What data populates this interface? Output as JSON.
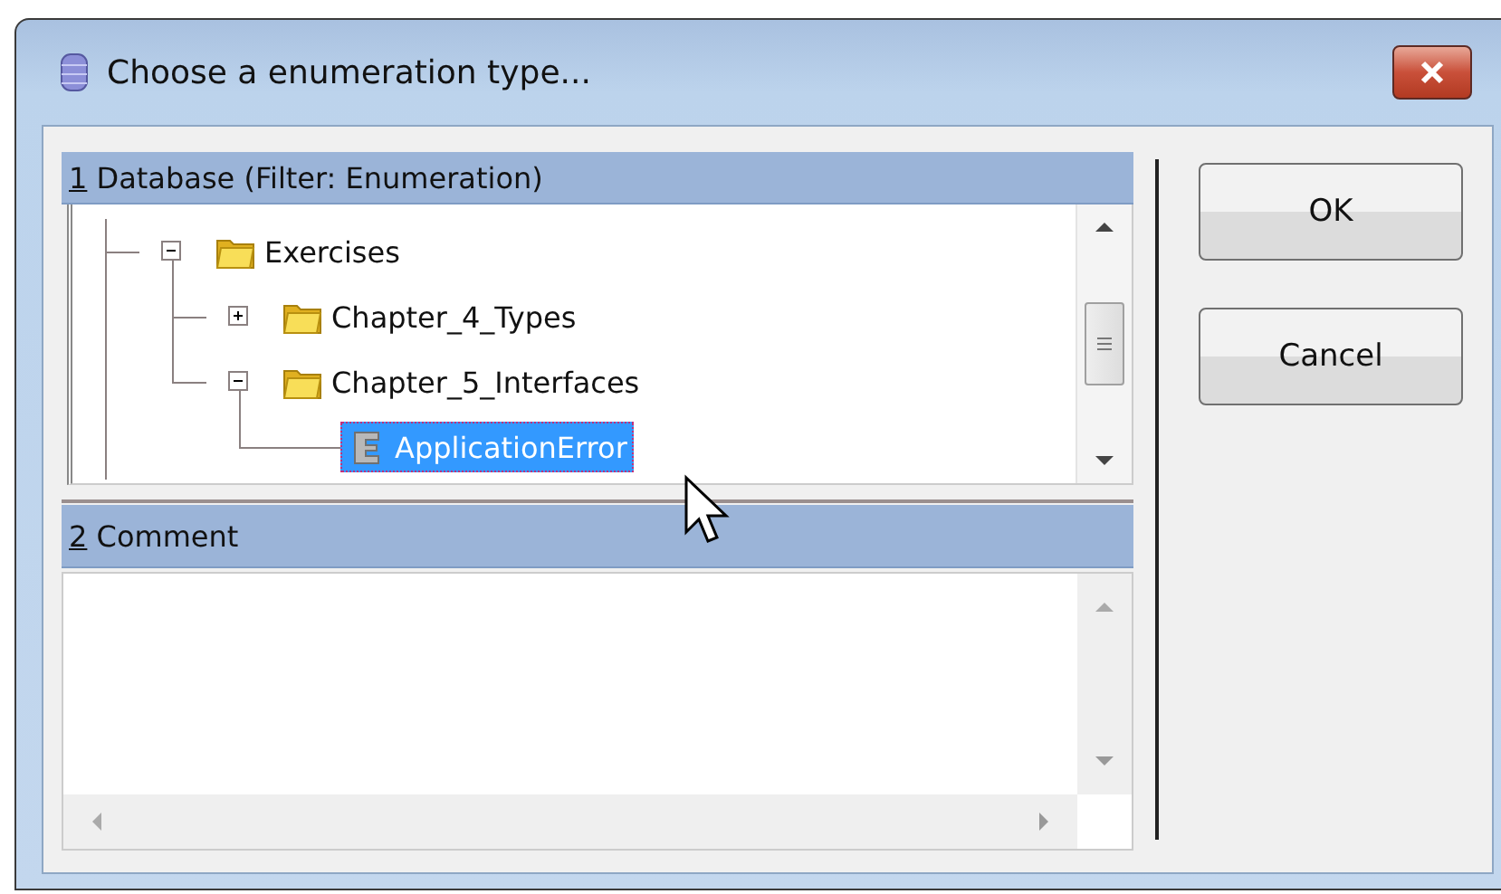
{
  "window": {
    "title": "Choose a enumeration type..."
  },
  "database_panel": {
    "access_key": "1",
    "label": "Database (Filter: Enumeration)",
    "tree": [
      {
        "label": "Exercises",
        "kind": "folder",
        "expanded": true,
        "selected": false,
        "children": [
          {
            "label": "Chapter_4_Types",
            "kind": "folder",
            "expanded": false,
            "selected": false
          },
          {
            "label": "Chapter_5_Interfaces",
            "kind": "folder",
            "expanded": true,
            "selected": false,
            "children": [
              {
                "label": "ApplicationError",
                "kind": "enumeration",
                "selected": true
              }
            ]
          }
        ]
      }
    ]
  },
  "comment_panel": {
    "access_key": "2",
    "label": "Comment"
  },
  "buttons": [
    "OK",
    "Cancel"
  ]
}
